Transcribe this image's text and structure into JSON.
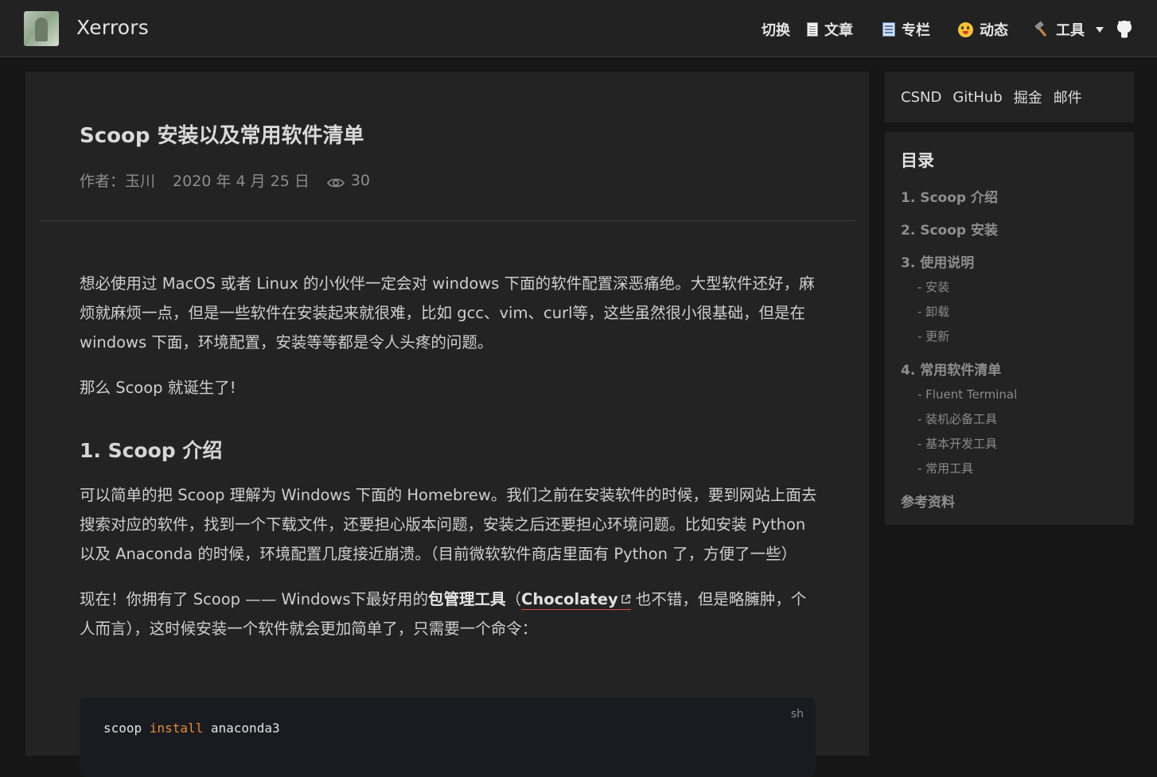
{
  "header": {
    "brand": "Xerrors",
    "nav": [
      {
        "label": "切换",
        "icon": "none"
      },
      {
        "label": "文章",
        "icon": "document-icon"
      },
      {
        "label": "专栏",
        "icon": "notebook-icon"
      },
      {
        "label": "动态",
        "icon": "silly-face-icon"
      },
      {
        "label": "工具",
        "icon": "hammer-icon"
      }
    ],
    "github_icon": "github-icon"
  },
  "article": {
    "title": "Scoop 安装以及常用软件清单",
    "author": "作者：玉川",
    "date": "2020 年 4 月 25 日",
    "views": "30",
    "p1": "想必使用过 MacOS 或者 Linux 的小伙伴一定会对 windows 下面的软件配置深恶痛绝。大型软件还好，麻烦就麻烦一点，但是一些软件在安装起来就很难，比如 gcc、vim、curl等，这些虽然很小很基础，但是在 windows 下面，环境配置，安装等等都是令人头疼的问题。",
    "p2": "那么 Scoop 就诞生了!",
    "h1": "1. Scoop 介绍",
    "p3": "可以简单的把 Scoop 理解为 Windows 下面的 Homebrew。我们之前在安装软件的时候，要到网站上面去搜索对应的软件，找到一个下载文件，还要担心版本问题，安装之后还要担心环境问题。比如安装 Python 以及 Anaconda 的时候，环境配置几度接近崩溃。（目前微软软件商店里面有 Python 了，方便了一些）",
    "p4_a": "现在！你拥有了 Scoop —— Windows下最好用的",
    "p4_strong": "包管理工具",
    "p4_b": "（",
    "p4_link": "Chocolatey",
    "p4_c": " 也不错，但是略臃肿，个人而言），这时候安装一个软件就会更加简单了，只需要一个命令：",
    "code_lang": "sh",
    "code_cmd": "scoop",
    "code_kw": "install",
    "code_arg": "anaconda3"
  },
  "sidebar": {
    "links": [
      "CSND",
      "GitHub",
      "掘金",
      "邮件"
    ],
    "toc_title": "目录",
    "toc": [
      {
        "label": "1. Scoop 介绍",
        "level": 1
      },
      {
        "label": "2. Scoop 安装",
        "level": 1
      },
      {
        "label": "3. 使用说明",
        "level": 1
      },
      {
        "label": "- 安装",
        "level": 2
      },
      {
        "label": "- 卸载",
        "level": 2
      },
      {
        "label": "- 更新",
        "level": 2
      },
      {
        "label": "4. 常用软件清单",
        "level": 1
      },
      {
        "label": "- Fluent Terminal",
        "level": 2
      },
      {
        "label": "- 装机必备工具",
        "level": 2
      },
      {
        "label": "- 基本开发工具",
        "level": 2
      },
      {
        "label": "- 常用工具",
        "level": 2
      },
      {
        "label": "参考资料",
        "level": 1
      }
    ]
  }
}
